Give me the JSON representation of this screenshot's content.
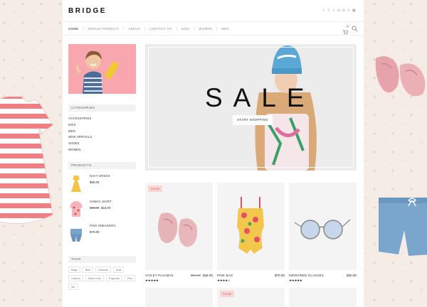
{
  "site": {
    "logo": "BRIDGE"
  },
  "social_icons": [
    "twitter-icon",
    "facebook-icon",
    "tumblr-icon",
    "instagram-icon",
    "linkedin-icon",
    "vimeo-icon",
    "share-icon"
  ],
  "nav": {
    "items": [
      "HOME",
      "SINGLE PRODUCT",
      "ABOUT",
      "CONTACT US",
      "KIDS",
      "WOMEN",
      "MEN"
    ],
    "cart_count": "0"
  },
  "sidebar": {
    "categories_title": "CATEGORIES",
    "categories": [
      "ACCESSORIES",
      "KIDS",
      "MEN",
      "NEW ARRIVALS",
      "SHOES",
      "WOMEN"
    ],
    "products_title": "PRODUCTS",
    "products": [
      {
        "name": "NAVY DRESS",
        "price": "$60.00"
      },
      {
        "name": "HAWAII SHIRT",
        "old_price": "$25.00",
        "price": "$15.00"
      },
      {
        "name": "PINK SNEAKERS",
        "price": "$70.00"
      }
    ],
    "tags_title": "TAGS",
    "tags": [
      "Bags",
      "Blue",
      "Glasses",
      "Kids",
      "Leather",
      "Multi Color",
      "Pajamas",
      "Pink",
      "Sin"
    ]
  },
  "hero": {
    "title": "SALE",
    "button": "START SHOPPING"
  },
  "grid": {
    "sale_label": "SALE",
    "products": [
      {
        "name": "VIOLET PAJAMAS",
        "old_price": "$55.00",
        "price": "$45.00",
        "sale": true,
        "rating": 5
      },
      {
        "name": "PINK BAG",
        "price": "$70.00",
        "sale": false,
        "rating": 4
      },
      {
        "name": "MIRRORED GLASSES",
        "price": "$30.00",
        "sale": false,
        "rating": 5
      }
    ]
  },
  "colors": {
    "accent_pink": "#f7a7ad",
    "sale_badge": "#f8d6d3"
  }
}
